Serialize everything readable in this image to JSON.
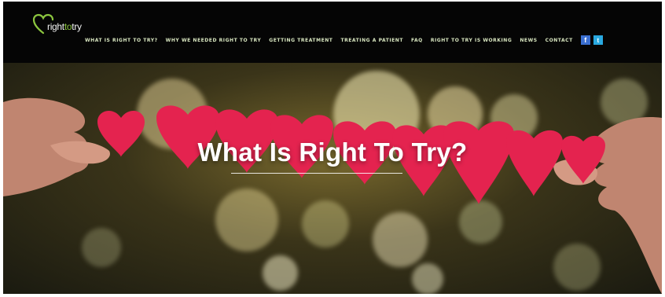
{
  "header": {
    "logo": {
      "text_part1": "right",
      "text_accent": "to",
      "text_part2": "try"
    },
    "nav": [
      "WHAT IS RIGHT TO TRY?",
      "WHY WE NEEDED RIGHT TO TRY",
      "GETTING TREATMENT",
      "TREATING A PATIENT",
      "FAQ",
      "RIGHT TO TRY IS WORKING",
      "NEWS",
      "CONTACT"
    ],
    "social": {
      "facebook": "f",
      "twitter": "t"
    }
  },
  "hero": {
    "title": "What Is Right To Try?"
  },
  "icons": [
    "heart-logo-icon",
    "facebook-icon",
    "twitter-icon"
  ],
  "colors": {
    "header_bg": "#050505",
    "nav_text": "#d8e6c0",
    "logo_accent": "#8cc63f",
    "heart": "#e4234f"
  }
}
